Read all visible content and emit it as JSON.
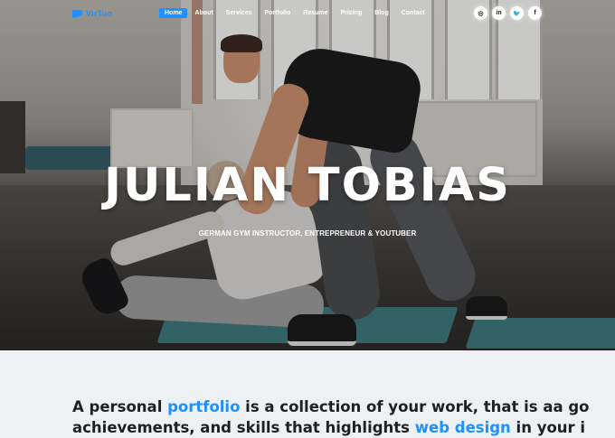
{
  "brand": {
    "logo_text": "VirTuo",
    "accent_color": "#1e90ff"
  },
  "nav": {
    "items": [
      {
        "label": "Home",
        "active": true
      },
      {
        "label": "About"
      },
      {
        "label": "Services"
      },
      {
        "label": "Portfolio"
      },
      {
        "label": "Resume"
      },
      {
        "label": "Pricing"
      },
      {
        "label": "Blog"
      },
      {
        "label": "Contact"
      }
    ],
    "socials": [
      {
        "icon": "instagram-icon",
        "glyph": "◎"
      },
      {
        "icon": "linkedin-icon",
        "glyph": "in"
      },
      {
        "icon": "twitter-icon",
        "glyph": "🐦"
      },
      {
        "icon": "facebook-icon",
        "glyph": "f"
      }
    ]
  },
  "hero": {
    "title": "JULIAN TOBIAS",
    "subtitle": "GERMAN GYM INSTRUCTOR, ENTREPRENEUR & YOUTUBER"
  },
  "about": {
    "line1_a": "A personal ",
    "line1_link": "portfolio",
    "line1_b": " is a collection of your work, that is aa go",
    "line2_a": "achievements, and skills that highlights ",
    "line2_link": "web design",
    "line2_b": " in your i"
  }
}
